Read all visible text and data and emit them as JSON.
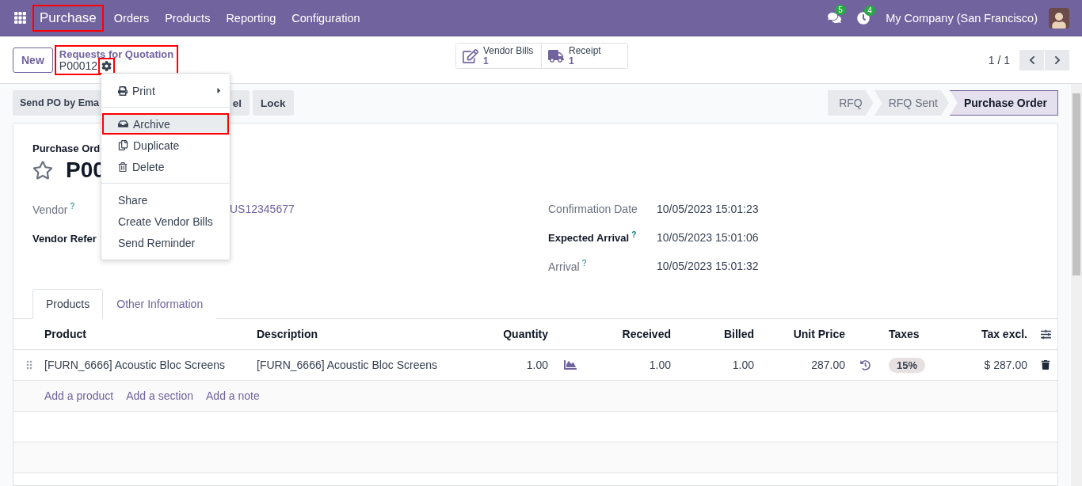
{
  "navbar": {
    "app_name": "Purchase",
    "app_highlighted": true,
    "menu": [
      "Orders",
      "Products",
      "Reporting",
      "Configuration"
    ],
    "messages_count": "5",
    "activities_count": "4",
    "company": "My Company (San Francisco)"
  },
  "control_panel": {
    "new_button": "New",
    "breadcrumb_parent": "Requests for Quotation",
    "breadcrumb_current": "P00012",
    "breadcrumb_highlighted": true,
    "gear_highlighted": true,
    "smart_buttons": [
      {
        "kind": "bills",
        "label": "Vendor Bills",
        "value": "1"
      },
      {
        "kind": "receipt",
        "label": "Receipt",
        "value": "1"
      }
    ],
    "pager": "1 / 1"
  },
  "action_menu": {
    "groups": [
      {
        "items": [
          {
            "kind": "print",
            "label": "Print",
            "selected": false,
            "highlighted": false,
            "submenu": true
          }
        ]
      },
      {
        "items": [
          {
            "kind": "archive",
            "label": "Archive",
            "selected": true,
            "highlighted": true,
            "submenu": false
          },
          {
            "kind": "duplicate",
            "label": "Duplicate",
            "selected": false,
            "highlighted": false,
            "submenu": false
          },
          {
            "kind": "delete",
            "label": "Delete",
            "selected": false,
            "highlighted": false,
            "submenu": false
          }
        ]
      },
      {
        "items": [
          {
            "kind": "plain",
            "label": "Share",
            "selected": false,
            "highlighted": false,
            "submenu": false
          },
          {
            "kind": "plain",
            "label": "Create Vendor Bills",
            "selected": false,
            "highlighted": false,
            "submenu": false
          },
          {
            "kind": "plain",
            "label": "Send Reminder",
            "selected": false,
            "highlighted": false,
            "submenu": false
          }
        ]
      }
    ]
  },
  "action_buttons": [
    "Send PO by Ema",
    "el",
    "Lock"
  ],
  "status_bar": [
    {
      "label": "RFQ",
      "selected": false
    },
    {
      "label": "RFQ Sent",
      "selected": false
    },
    {
      "label": "Purchase Order",
      "selected": true
    }
  ],
  "sheet": {
    "title_label": "Purchase Ord",
    "starred": false,
    "title": "P00",
    "left_fields": [
      {
        "label": "Vendor",
        "help": "?",
        "value": "US12345677",
        "bold": false
      },
      {
        "label": "Vendor Refer",
        "bold": true
      }
    ],
    "right_fields": [
      {
        "label": "Confirmation Date",
        "value": "10/05/2023 15:01:23",
        "bold": false
      },
      {
        "label": "Expected Arrival",
        "help": "?",
        "value": "10/05/2023 15:01:06",
        "bold": true
      },
      {
        "label": "Arrival",
        "help": "?",
        "value": "10/05/2023 15:01:32",
        "bold": false
      }
    ]
  },
  "tabs": [
    {
      "label": "Products",
      "selected": true
    },
    {
      "label": "Other Information",
      "selected": false
    }
  ],
  "table": {
    "columns": [
      "Product",
      "Description",
      "Quantity",
      "Received",
      "Billed",
      "Unit Price",
      "Taxes",
      "Tax excl."
    ],
    "rows": [
      {
        "product": "[FURN_6666] Acoustic Bloc Screens",
        "description": "[FURN_6666] Acoustic Bloc Screens",
        "quantity": "1.00",
        "received": "1.00",
        "billed": "1.00",
        "unit_price": "287.00",
        "taxes": [
          "15%"
        ],
        "subtotal": "$ 287.00"
      }
    ],
    "add_links": [
      "Add a product",
      "Add a section",
      "Add a note"
    ]
  }
}
